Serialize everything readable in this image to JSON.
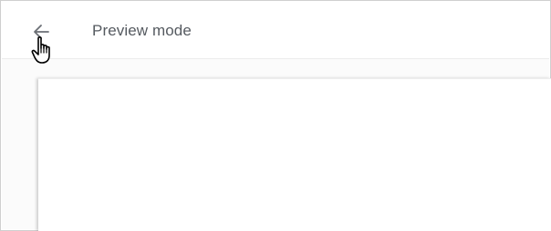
{
  "header": {
    "back_icon": "arrow-left-icon",
    "title": "Preview mode"
  },
  "colors": {
    "title_text": "#555a60",
    "icon": "#6b6f75",
    "divider": "#ececec",
    "canvas_bg": "#fbfbfb"
  },
  "overlay": {
    "cursor_icon": "hand-pointer-icon"
  }
}
